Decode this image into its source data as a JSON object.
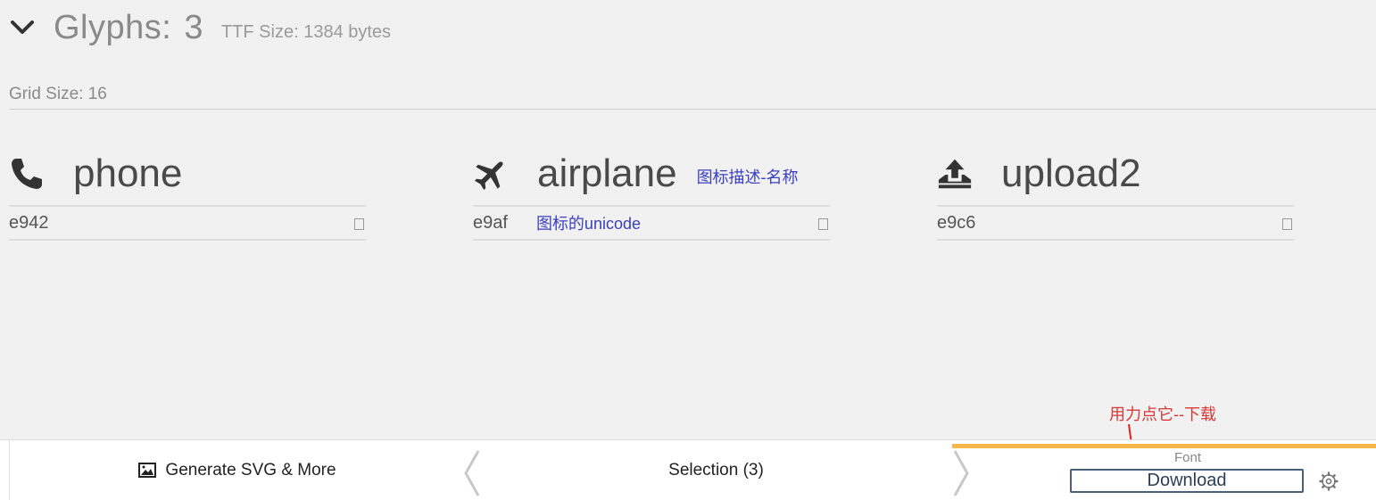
{
  "header": {
    "glyphs_label": "Glyphs:",
    "glyph_count": "3",
    "ttf_size": "TTF Size: 1384 bytes"
  },
  "grid": {
    "label": "Grid Size: 16"
  },
  "glyphs": [
    {
      "name": "phone",
      "code": "e942",
      "icon": "phone-icon"
    },
    {
      "name": "airplane",
      "code": "e9af",
      "icon": "airplane-icon",
      "annotation_name": "图标描述-名称",
      "annotation_code": "图标的unicode"
    },
    {
      "name": "upload2",
      "code": "e9c6",
      "icon": "upload-icon"
    }
  ],
  "footer": {
    "generate_label": "Generate SVG & More",
    "selection_label": "Selection (3)",
    "font_label": "Font",
    "download_label": "Download"
  },
  "annotation": {
    "download_hint": "用力点它--下载"
  },
  "colors": {
    "annotation_blue": "#3a3fbf",
    "annotation_red": "#d93838",
    "accent_orange": "#f7b64a",
    "button_border": "#4a5f7a"
  }
}
